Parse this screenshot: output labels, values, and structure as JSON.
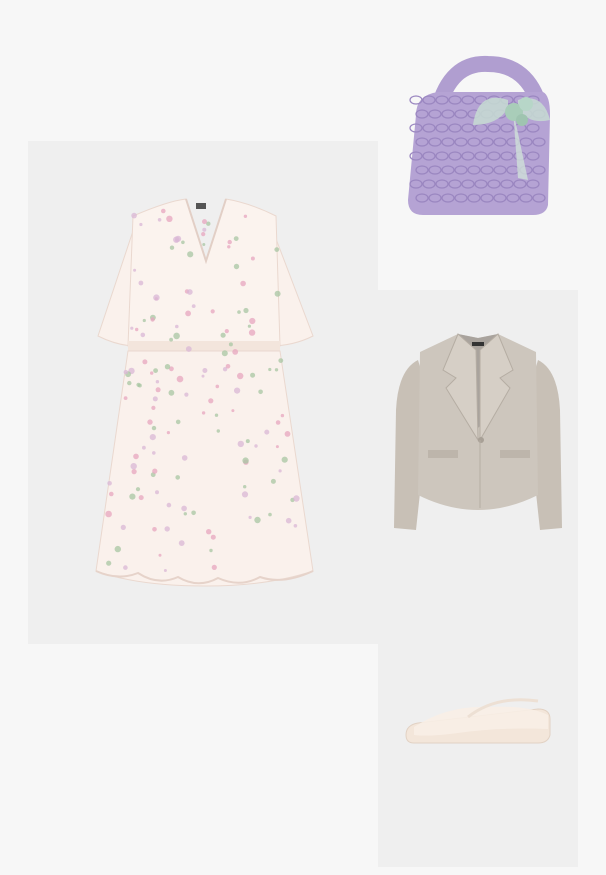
{
  "outfit": {
    "items": [
      {
        "id": "dress",
        "label": "",
        "kind": "floral chiffon mini dress"
      },
      {
        "id": "bag",
        "label": "",
        "kind": "woven lilac handbag"
      },
      {
        "id": "blazer",
        "label": "",
        "kind": "beige tailored blazer"
      },
      {
        "id": "flats",
        "label": "",
        "kind": "mesh ballet flats"
      }
    ]
  },
  "colors": {
    "page_bg": "#f7f7f7",
    "panel_bg": "#efefef",
    "dress_base": "#faf1ec",
    "dress_pink": "#e7a6bf",
    "dress_green": "#a8c5a3",
    "bag_lilac": "#b5a3d4",
    "bag_shadow": "#9a86c0",
    "bow_mint": "#b7d6c8",
    "blazer": "#cdc6bd",
    "blazer_shadow": "#b5ada3",
    "flats": "#f3e6da"
  }
}
